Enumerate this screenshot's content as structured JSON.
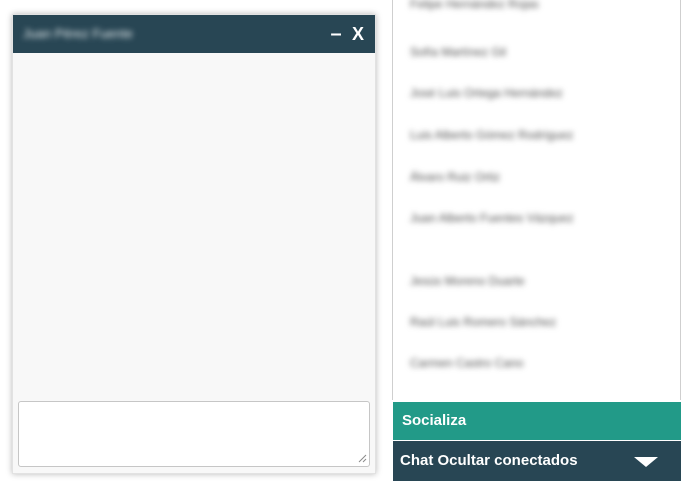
{
  "chat_window": {
    "title": "Juan Pérez Fuente",
    "minimize_label": "–",
    "close_label": "X",
    "message_value": ""
  },
  "contacts": [
    "Felipe Hernández Rojas",
    "Sofía Martínez Gil",
    "José Luis Ortega Hernández",
    "Luis Alberto Gómez Rodríguez",
    "Álvaro Ruiz Ortiz",
    "Juan Alberto Fuentes Vázquez",
    "Jesús Moreno Duarte",
    "Raúl Luis Romero Sánchez",
    "Carmen Castro Cano"
  ],
  "bars": {
    "socialize_label": "Socializa",
    "chat_label": "Chat Ocultar conectados"
  },
  "colors": {
    "header": "#284654",
    "socialize": "#229a88",
    "chat_bar": "#284654"
  },
  "icons": {
    "chat_bar_toggle": "triangle-down-icon",
    "resize_grip": "resize-grip-icon"
  }
}
